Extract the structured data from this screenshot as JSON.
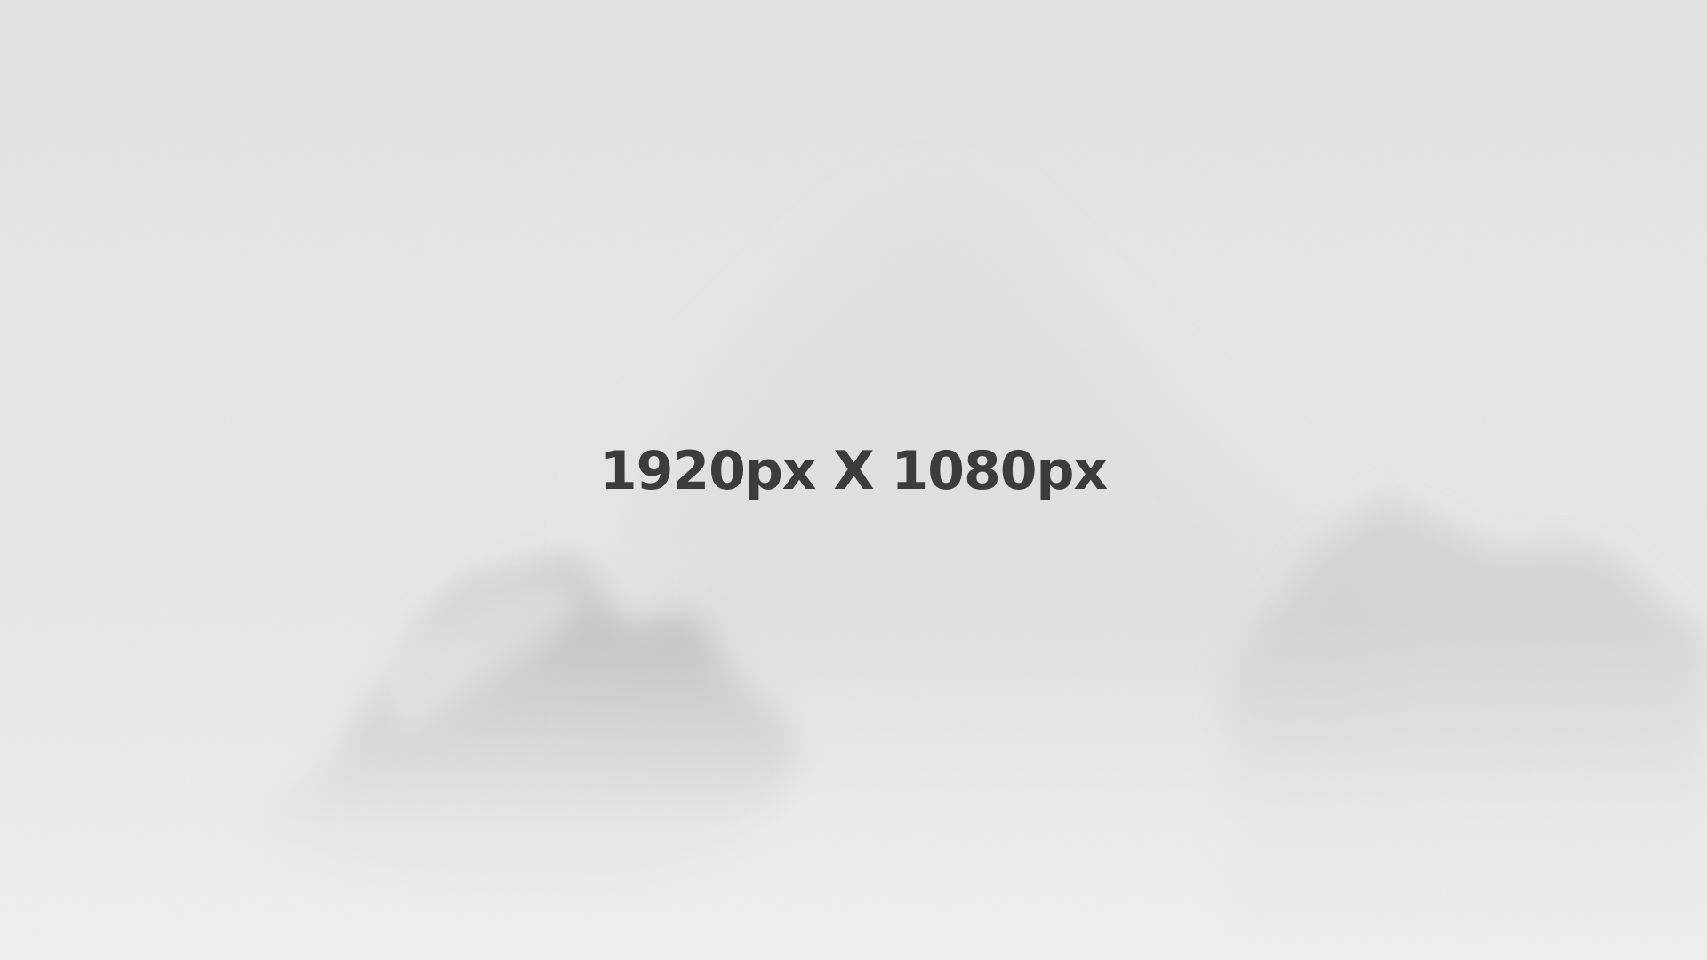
{
  "headline": {
    "text": "1920px X 1080px",
    "color": "#3c3c3c"
  },
  "background": {
    "description_icon": "foggy-mountain-image",
    "sky_color": "#e4e4e4",
    "rock_color": "#b9b9b9",
    "snow_color": "#f1f1f1"
  }
}
